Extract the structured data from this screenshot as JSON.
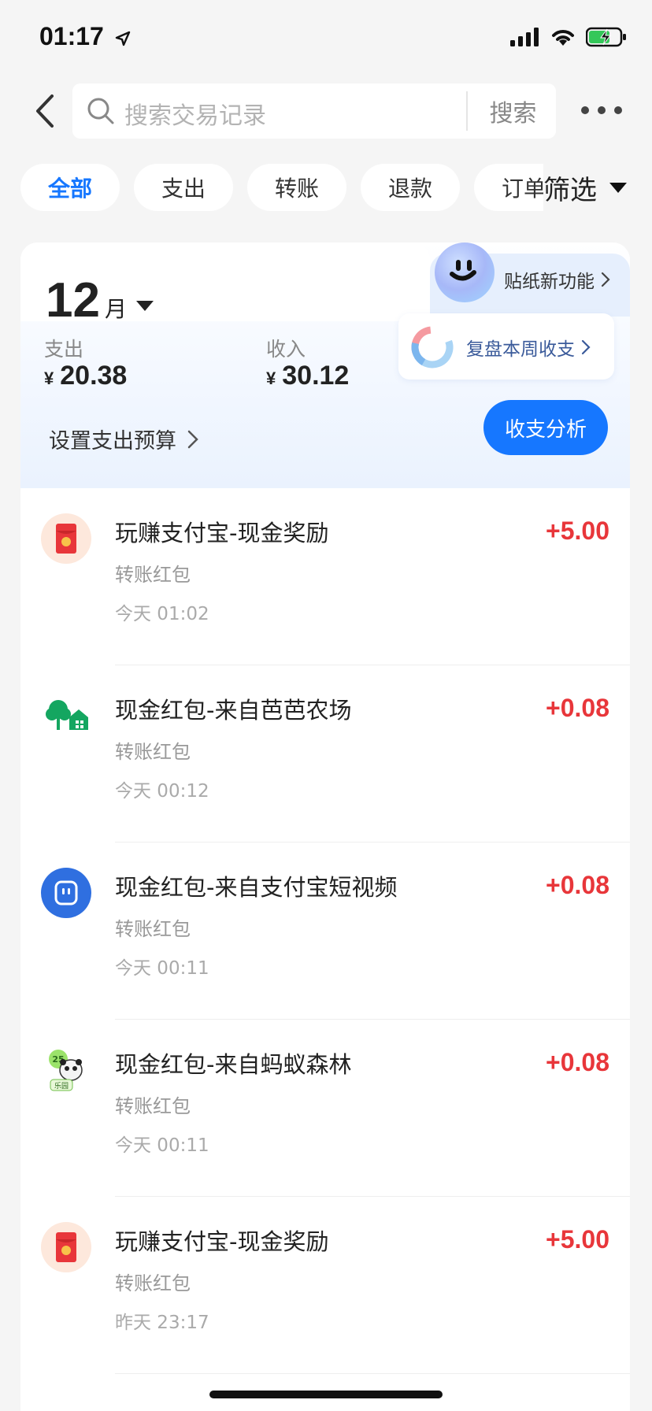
{
  "status": {
    "time": "01:17"
  },
  "search": {
    "placeholder": "搜索交易记录",
    "button_label": "搜索"
  },
  "tabs": [
    {
      "label": "全部",
      "active": true
    },
    {
      "label": "支出",
      "active": false
    },
    {
      "label": "转账",
      "active": false
    },
    {
      "label": "退款",
      "active": false
    },
    {
      "label": "订单",
      "active": false
    }
  ],
  "filter_label": "筛选",
  "summary": {
    "month": "12",
    "month_unit": "月",
    "expense_label": "支出",
    "expense_value": "20.38",
    "income_label": "收入",
    "income_value": "30.12",
    "currency": "¥",
    "budget_label": "设置支出预算",
    "sticker_label": "贴纸新功能",
    "review_label": "复盘本周收支",
    "analysis_label": "收支分析"
  },
  "transactions": [
    {
      "title": "玩赚支付宝-现金奖励",
      "amount": "+5.00",
      "category": "转账红包",
      "time": "今天 01:02",
      "icon": "red-envelope-icon"
    },
    {
      "title": "现金红包-来自芭芭农场",
      "amount": "+0.08",
      "category": "转账红包",
      "time": "今天 00:12",
      "icon": "farm-icon"
    },
    {
      "title": "现金红包-来自支付宝短视频",
      "amount": "+0.08",
      "category": "转账红包",
      "time": "今天 00:11",
      "icon": "short-video-icon"
    },
    {
      "title": "现金红包-来自蚂蚁森林",
      "amount": "+0.08",
      "category": "转账红包",
      "time": "今天 00:11",
      "icon": "ant-forest-panda-icon",
      "icon_badge": "25",
      "icon_tag": "乐园"
    },
    {
      "title": "玩赚支付宝-现金奖励",
      "amount": "+5.00",
      "category": "转账红包",
      "time": "昨天 23:17",
      "icon": "red-envelope-icon"
    }
  ],
  "colors": {
    "accent": "#1677ff",
    "income": "#e8363a",
    "background": "#f5f5f5"
  }
}
